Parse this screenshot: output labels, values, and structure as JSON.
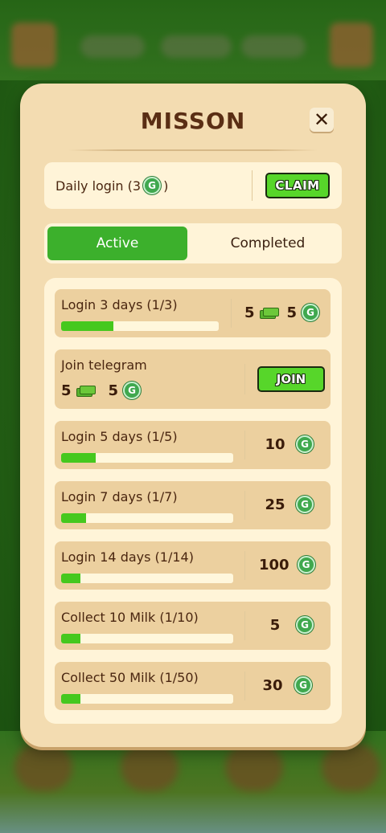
{
  "modal": {
    "title": "MISSON",
    "close_label": "✕"
  },
  "daily": {
    "label_prefix": "Daily login (3",
    "label_suffix": ")",
    "coin_glyph": "G",
    "claim_label": "CLAIM"
  },
  "tabs": [
    {
      "label": "Active",
      "selected": true
    },
    {
      "label": "Completed",
      "selected": false
    }
  ],
  "missions": [
    {
      "title": "Login 3 days (1/3)",
      "progress": 0.333,
      "rewards": [
        {
          "amount": "5",
          "type": "cash"
        },
        {
          "amount": "5",
          "type": "coin"
        }
      ]
    },
    {
      "title": "Join telegram",
      "action": "JOIN",
      "rewards": [
        {
          "amount": "5",
          "type": "cash"
        },
        {
          "amount": "5",
          "type": "coin"
        }
      ]
    },
    {
      "title": "Login 5 days (1/5)",
      "progress": 0.2,
      "rewards": [
        {
          "amount": "10",
          "type": "coin"
        }
      ]
    },
    {
      "title": "Login 7 days (1/7)",
      "progress": 0.143,
      "rewards": [
        {
          "amount": "25",
          "type": "coin"
        }
      ]
    },
    {
      "title": "Login 14 days (1/14)",
      "progress": 0.071,
      "rewards": [
        {
          "amount": "100",
          "type": "coin"
        }
      ]
    },
    {
      "title": "Collect 10 Milk (1/10)",
      "progress": 0.1,
      "rewards": [
        {
          "amount": "5",
          "type": "coin"
        }
      ]
    },
    {
      "title": "Collect 50 Milk (1/50)",
      "progress": 0.02,
      "rewards": [
        {
          "amount": "30",
          "type": "coin"
        }
      ]
    }
  ],
  "colors": {
    "accent_green": "#3cb02c",
    "progress_green": "#45c81e",
    "panel": "#f3dcb1",
    "title_brown": "#5a2e14"
  }
}
